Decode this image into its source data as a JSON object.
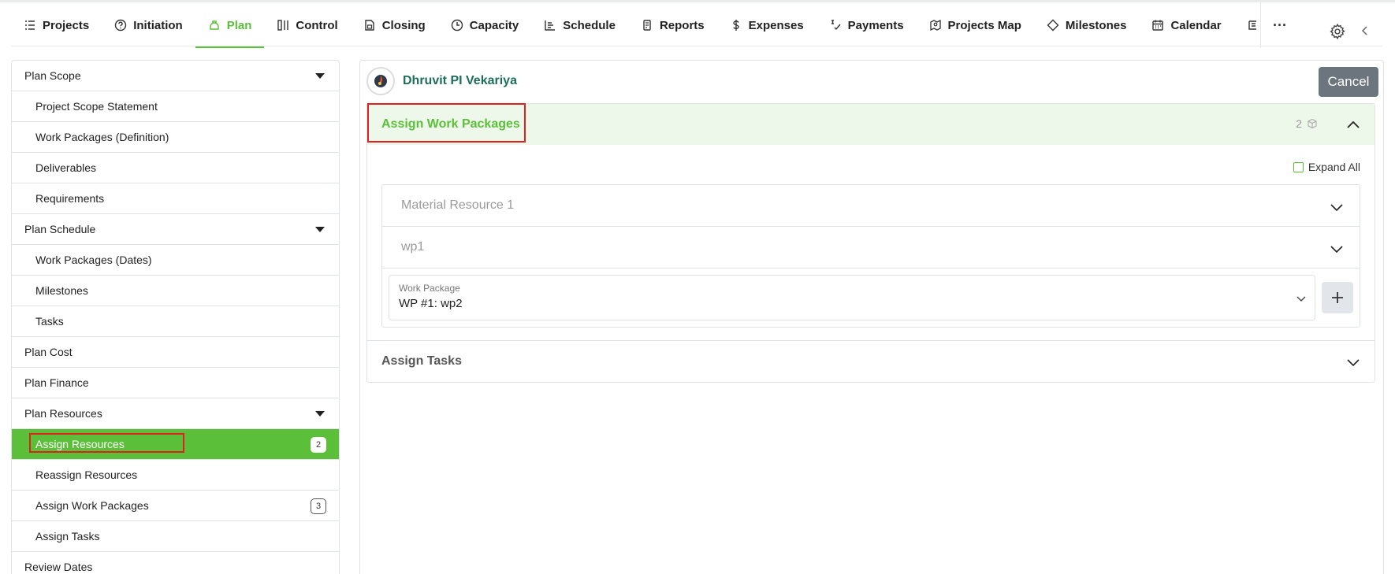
{
  "nav": {
    "tabs": [
      {
        "label": "Projects",
        "icon": "list-icon"
      },
      {
        "label": "Initiation",
        "icon": "question-circle-icon"
      },
      {
        "label": "Plan",
        "icon": "plan-icon",
        "active": true
      },
      {
        "label": "Control",
        "icon": "control-icon"
      },
      {
        "label": "Closing",
        "icon": "lock-doc-icon"
      },
      {
        "label": "Capacity",
        "icon": "clock-icon"
      },
      {
        "label": "Schedule",
        "icon": "schedule-icon"
      },
      {
        "label": "Reports",
        "icon": "reports-icon"
      },
      {
        "label": "Expenses",
        "icon": "dollar-icon"
      },
      {
        "label": "Payments",
        "icon": "payments-icon"
      },
      {
        "label": "Projects Map",
        "icon": "map-icon"
      },
      {
        "label": "Milestones",
        "icon": "diamond-icon"
      },
      {
        "label": "Calendar",
        "icon": "calendar-icon"
      }
    ],
    "more_label": "···",
    "accent": "#5cbf3a"
  },
  "sidebar": {
    "items": [
      {
        "label": "Plan Scope",
        "level": 0,
        "caret": true
      },
      {
        "label": "Project Scope Statement",
        "level": 1
      },
      {
        "label": "Work Packages (Definition)",
        "level": 1
      },
      {
        "label": "Deliverables",
        "level": 1
      },
      {
        "label": "Requirements",
        "level": 1
      },
      {
        "label": "Plan Schedule",
        "level": 0,
        "caret": true
      },
      {
        "label": "Work Packages (Dates)",
        "level": 1
      },
      {
        "label": "Milestones",
        "level": 1
      },
      {
        "label": "Tasks",
        "level": 1
      },
      {
        "label": "Plan Cost",
        "level": 0
      },
      {
        "label": "Plan Finance",
        "level": 0
      },
      {
        "label": "Plan Resources",
        "level": 0,
        "caret": true
      },
      {
        "label": "Assign Resources",
        "level": 1,
        "active": true,
        "badge": "2"
      },
      {
        "label": "Reassign Resources",
        "level": 1
      },
      {
        "label": "Assign Work Packages",
        "level": 1,
        "badge": "3"
      },
      {
        "label": "Assign Tasks",
        "level": 1
      },
      {
        "label": "Review Dates",
        "level": 0
      }
    ]
  },
  "main": {
    "user_name": "Dhruvit PI Vekariya",
    "cancel_label": "Cancel",
    "section_title": "Assign Work Packages",
    "section_count": "2",
    "expand_all_label": "Expand All",
    "resources": [
      {
        "name": "Material Resource 1"
      },
      {
        "name": "wp1"
      }
    ],
    "work_package": {
      "label": "Work Package",
      "value": "WP #1: wp2"
    },
    "second_section_title": "Assign Tasks"
  }
}
